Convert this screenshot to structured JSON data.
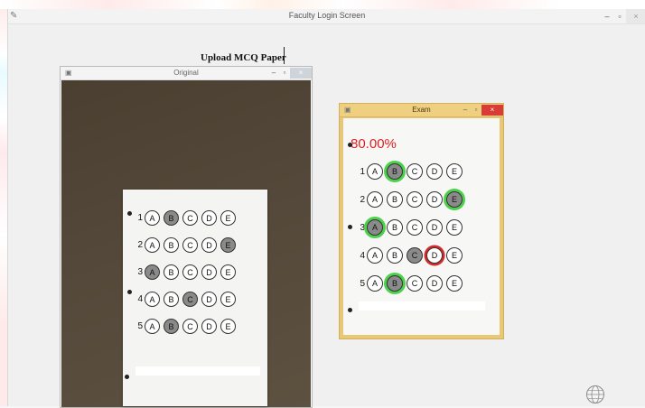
{
  "main": {
    "title": "Faculty Login Screen",
    "minimize": "–",
    "maximize": "▫",
    "close": "×",
    "upload_label": "Upload MCQ Paper"
  },
  "original_window": {
    "title": "Original",
    "minimize": "–",
    "maximize": "▫",
    "close": "×",
    "sheet": {
      "questions": [
        {
          "number": "1",
          "options": [
            "A",
            "B",
            "C",
            "D",
            "E"
          ],
          "marked": "B"
        },
        {
          "number": "2",
          "options": [
            "A",
            "B",
            "C",
            "D",
            "E"
          ],
          "marked": "E"
        },
        {
          "number": "3",
          "options": [
            "A",
            "B",
            "C",
            "D",
            "E"
          ],
          "marked": "A"
        },
        {
          "number": "4",
          "options": [
            "A",
            "B",
            "C",
            "D",
            "E"
          ],
          "marked": "C"
        },
        {
          "number": "5",
          "options": [
            "A",
            "B",
            "C",
            "D",
            "E"
          ],
          "marked": "B"
        }
      ]
    }
  },
  "exam_window": {
    "title": "Exam",
    "minimize": "–",
    "maximize": "▫",
    "close": "×",
    "score": "80.00%",
    "questions": [
      {
        "number": "1",
        "options": [
          "A",
          "B",
          "C",
          "D",
          "E"
        ],
        "marked": "B",
        "correct": "B"
      },
      {
        "number": "2",
        "options": [
          "A",
          "B",
          "C",
          "D",
          "E"
        ],
        "marked": "E",
        "correct": "E"
      },
      {
        "number": "3",
        "options": [
          "A",
          "B",
          "C",
          "D",
          "E"
        ],
        "marked": "A",
        "correct": "A"
      },
      {
        "number": "4",
        "options": [
          "A",
          "B",
          "C",
          "D",
          "E"
        ],
        "marked": "C",
        "correct": "D"
      },
      {
        "number": "5",
        "options": [
          "A",
          "B",
          "C",
          "D",
          "E"
        ],
        "marked": "B",
        "correct": "B"
      }
    ]
  },
  "colors": {
    "correct": "#4bd14b",
    "wrong": "#d42a2a",
    "score": "#e01f22",
    "exam_frame": "#e8c777"
  }
}
